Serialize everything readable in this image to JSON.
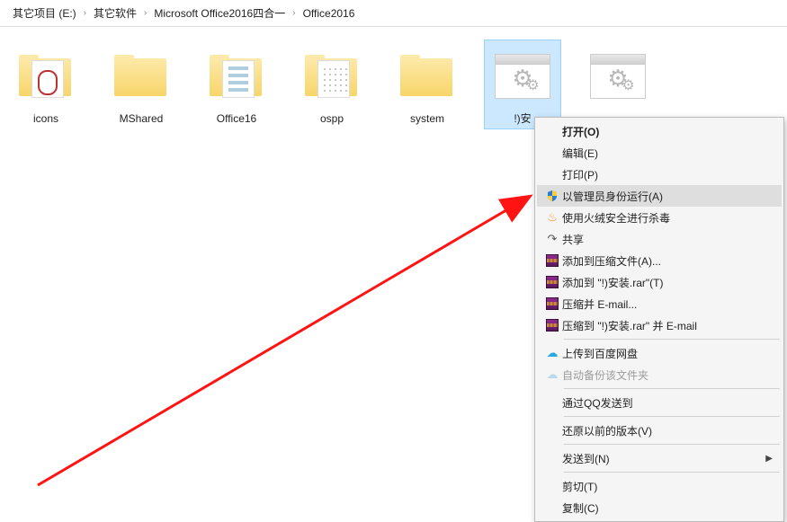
{
  "breadcrumb": {
    "seg1": "其它项目 (E:)",
    "seg2": "其它软件",
    "seg3": "Microsoft Office2016四合一",
    "seg4": "Office2016"
  },
  "items": [
    {
      "label": "icons"
    },
    {
      "label": "MShared"
    },
    {
      "label": "Office16"
    },
    {
      "label": "ospp"
    },
    {
      "label": "system"
    },
    {
      "label": "!)安"
    },
    {
      "label": ""
    }
  ],
  "context_menu": {
    "open": "打开(O)",
    "edit": "编辑(E)",
    "print": "打印(P)",
    "run_as_admin": "以管理员身份运行(A)",
    "huorong_scan": "使用火绒安全进行杀毒",
    "share": "共享",
    "add_to_archive": "添加到压缩文件(A)...",
    "add_to_rar": "添加到 \"!)安装.rar\"(T)",
    "compress_email": "压缩并 E-mail...",
    "compress_rar_email": "压缩到 \"!)安装.rar\" 并 E-mail",
    "upload_baidu": "上传到百度网盘",
    "auto_backup": "自动备份该文件夹",
    "qq_send": "通过QQ发送到",
    "restore_versions": "还原以前的版本(V)",
    "send_to": "发送到(N)",
    "cut": "剪切(T)",
    "copy": "复制(C)"
  }
}
